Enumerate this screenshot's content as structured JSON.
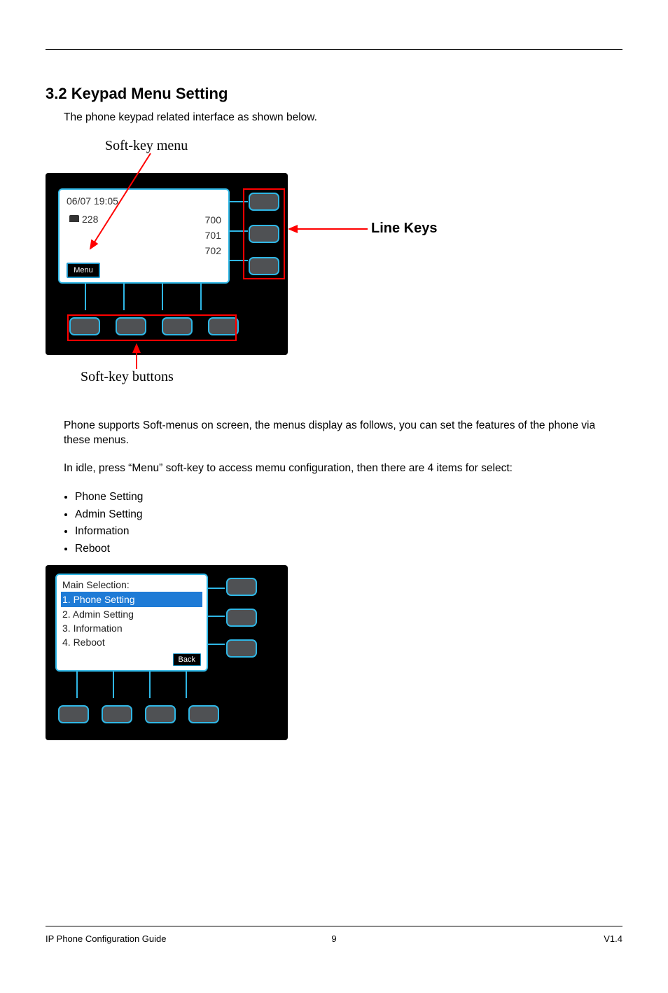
{
  "header": {
    "doc_title": "IP Phone Configuration Guide",
    "version": "V1.4"
  },
  "section": {
    "heading": "3.2 Keypad Menu Setting",
    "intro": "The phone keypad related interface as shown below."
  },
  "figure": {
    "label_softkey_menu": "Soft-key menu",
    "label_line_keys": "Line Keys",
    "label_softkey_buttons": "Soft-key buttons",
    "screen": {
      "datetime": "06/07  19:05",
      "ext_number": "228",
      "menu_softkey": "Menu",
      "line_labels": [
        "700",
        "701",
        "702"
      ]
    }
  },
  "soft_menu": {
    "intro": "Phone supports Soft-menus on screen, the menus display as follows, you can set the features of the phone via these menus.",
    "explain": "In idle, press “Menu” soft-key to access memu configuration, then there are 4 items for select:",
    "items": [
      "Phone Setting",
      "Admin Setting",
      "Information",
      "Reboot"
    ]
  },
  "menu_screen": {
    "title": "Main Selection:",
    "entries": [
      "1. Phone Setting",
      "2. Admin Setting",
      "3. Information",
      "4. Reboot"
    ],
    "back": "Back"
  },
  "footer": {
    "page_number": "9"
  }
}
